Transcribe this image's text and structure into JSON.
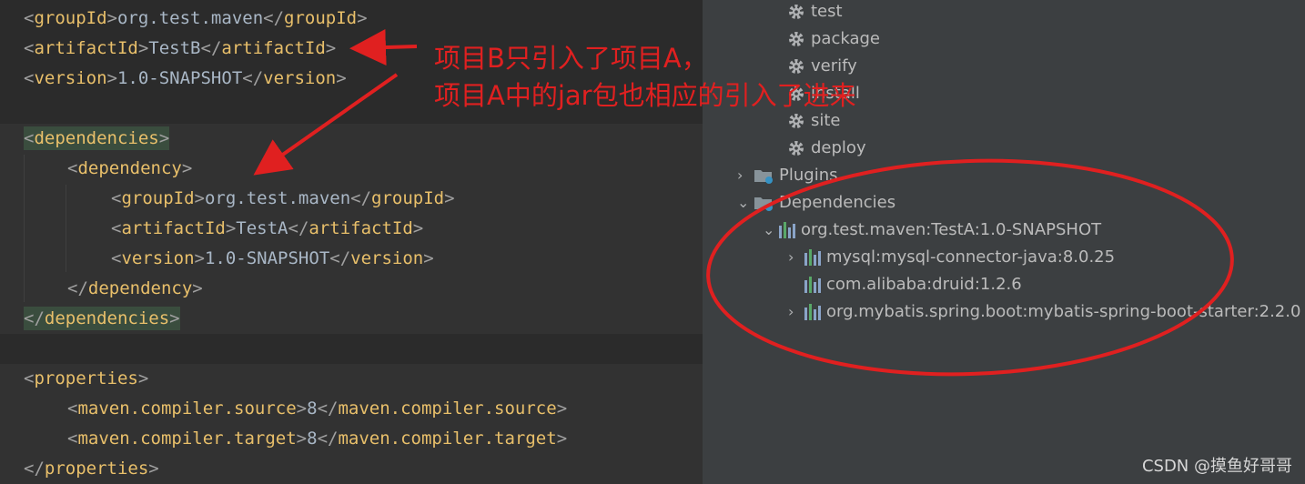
{
  "editor": {
    "lines": [
      {
        "indent": 1,
        "tag": "groupId",
        "text": "org.test.maven"
      },
      {
        "indent": 1,
        "tag": "artifactId",
        "text": "TestB"
      },
      {
        "indent": 1,
        "tag": "version",
        "text": "1.0-SNAPSHOT"
      },
      {
        "indent": 0,
        "blank": true
      },
      {
        "indent": 1,
        "open": "dependencies",
        "highlight": true
      },
      {
        "indent": 2,
        "open": "dependency"
      },
      {
        "indent": 3,
        "tag": "groupId",
        "text": "org.test.maven"
      },
      {
        "indent": 3,
        "tag": "artifactId",
        "text": "TestA"
      },
      {
        "indent": 3,
        "tag": "version",
        "text": "1.0-SNAPSHOT"
      },
      {
        "indent": 2,
        "close": "dependency"
      },
      {
        "indent": 1,
        "close": "dependencies",
        "highlight": true
      },
      {
        "indent": 0,
        "blank": true
      },
      {
        "indent": 1,
        "open": "properties"
      },
      {
        "indent": 2,
        "tag": "maven.compiler.source",
        "text": "8"
      },
      {
        "indent": 2,
        "tag": "maven.compiler.target",
        "text": "8"
      },
      {
        "indent": 1,
        "close": "properties"
      }
    ]
  },
  "maven": {
    "lifecycle": [
      "test",
      "package",
      "verify",
      "install",
      "site",
      "deploy"
    ],
    "plugins_label": "Plugins",
    "dependencies_label": "Dependencies",
    "root_dependency": "org.test.maven:TestA:1.0-SNAPSHOT",
    "children": [
      {
        "label": "mysql:mysql-connector-java:8.0.25",
        "expandable": true
      },
      {
        "label": "com.alibaba:druid:1.2.6",
        "expandable": false
      },
      {
        "label": "org.mybatis.spring.boot:mybatis-spring-boot-starter:2.2.0",
        "expandable": true
      }
    ]
  },
  "annotation": {
    "line1": "项目B只引入了项目A，",
    "line2": "项目A中的jar包也相应的引入了进来",
    "color": "#e02020"
  },
  "watermark": "CSDN @摸鱼好哥哥"
}
